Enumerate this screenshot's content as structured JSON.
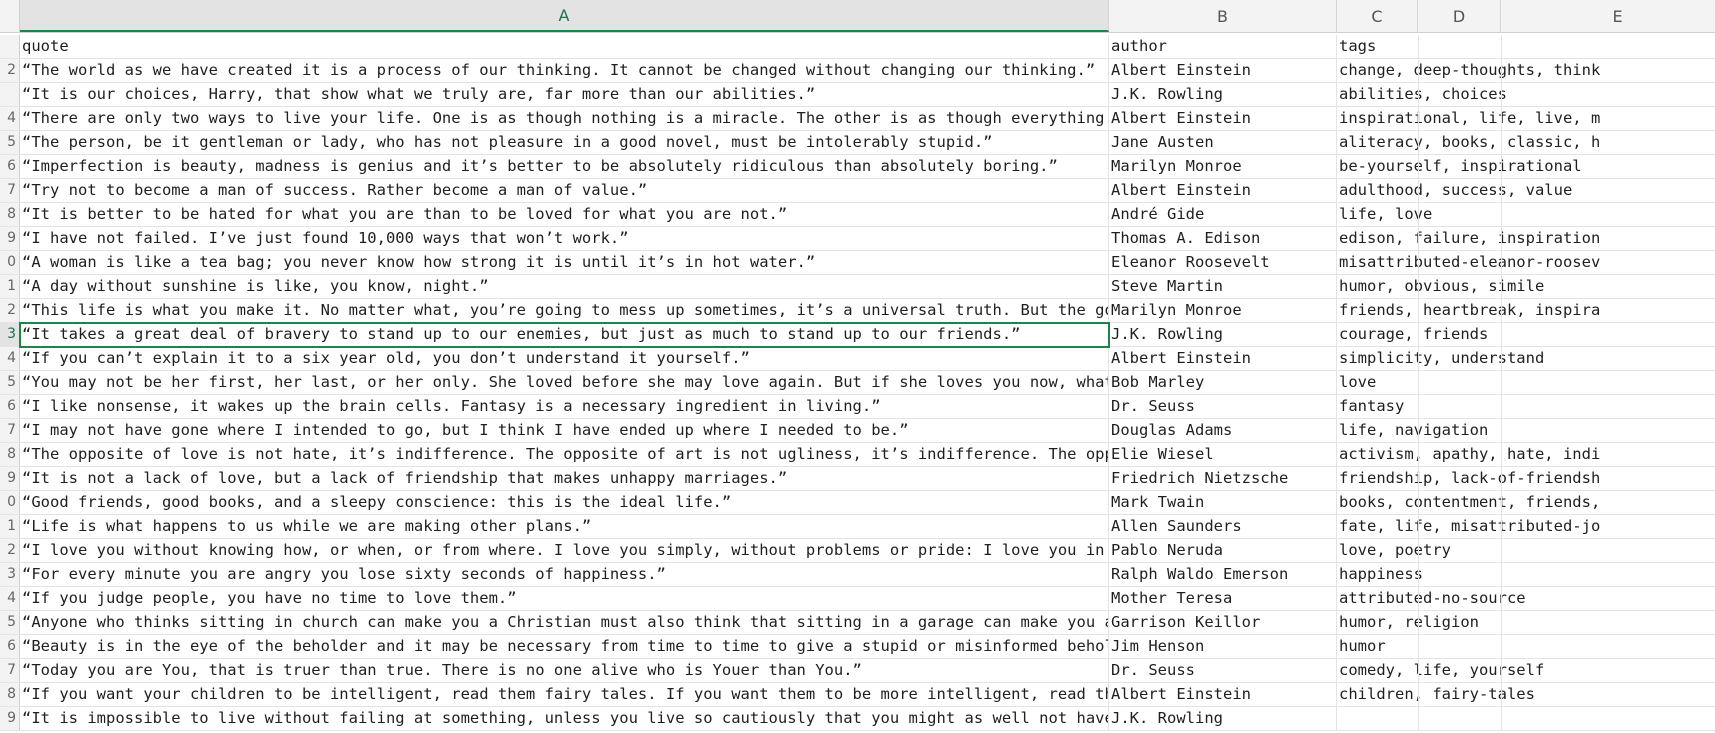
{
  "columns": [
    {
      "letter": "A",
      "selected": true
    },
    {
      "letter": "B",
      "selected": false
    },
    {
      "letter": "C",
      "selected": false
    },
    {
      "letter": "D",
      "selected": false
    },
    {
      "letter": "E",
      "selected": false
    }
  ],
  "rows": [
    {
      "num": "",
      "quote": "quote",
      "author": "author",
      "tags": "tags"
    },
    {
      "num": "2",
      "quote": "“The world as we have created it is a process of our thinking. It cannot be changed without changing our thinking.”",
      "author": "Albert Einstein",
      "tags": "change, deep-thoughts, think"
    },
    {
      "num": "",
      "quote": "“It is our choices, Harry, that show what we truly are, far more than our abilities.”",
      "author": "J.K. Rowling",
      "tags": "abilities, choices"
    },
    {
      "num": "4",
      "quote": "“There are only two ways to live your life. One is as though nothing is a miracle. The other is as though everything is a miracle.”",
      "author": "Albert Einstein",
      "tags": "inspirational, life, live, m"
    },
    {
      "num": "5",
      "quote": "“The person, be it gentleman or lady, who has not pleasure in a good novel, must be intolerably stupid.”",
      "author": "Jane Austen",
      "tags": "aliteracy, books, classic, h"
    },
    {
      "num": "6",
      "quote": "“Imperfection is beauty, madness is genius and it’s better to be absolutely ridiculous than absolutely boring.”",
      "author": "Marilyn Monroe",
      "tags": "be-yourself, inspirational"
    },
    {
      "num": "7",
      "quote": "“Try not to become a man of success. Rather become a man of value.”",
      "author": "Albert Einstein",
      "tags": "adulthood, success, value"
    },
    {
      "num": "8",
      "quote": "“It is better to be hated for what you are than to be loved for what you are not.”",
      "author": "André Gide",
      "tags": "life, love"
    },
    {
      "num": "9",
      "quote": "“I have not failed. I’ve just found 10,000 ways that won’t work.”",
      "author": "Thomas A. Edison",
      "tags": "edison, failure, inspiration"
    },
    {
      "num": "0",
      "quote": "“A woman is like a tea bag; you never know how strong it is until it’s in hot water.”",
      "author": "Eleanor Roosevelt",
      "tags": "misattributed-eleanor-roosev"
    },
    {
      "num": "1",
      "quote": "“A day without sunshine is like, you know, night.”",
      "author": "Steve Martin",
      "tags": "humor, obvious, simile"
    },
    {
      "num": "2",
      "quote": "“This life is what you make it. No matter what, you’re going to mess up sometimes, it’s a universal truth. But the good part is you",
      "author": "Marilyn Monroe",
      "tags": "friends, heartbreak, inspira"
    },
    {
      "num": "3",
      "quote": "“It takes a great deal of bravery to stand up to our enemies, but just as much to stand up to our friends.”",
      "author": "J.K. Rowling",
      "tags": "courage, friends"
    },
    {
      "num": "4",
      "quote": "“If you can’t explain it to a six year old, you don’t understand it yourself.”",
      "author": "Albert Einstein",
      "tags": "simplicity, understand"
    },
    {
      "num": "5",
      "quote": "“You may not be her first, her last, or her only. She loved before she may love again. But if she loves you now, what else matters?",
      "author": "Bob Marley",
      "tags": "love"
    },
    {
      "num": "6",
      "quote": "“I like nonsense, it wakes up the brain cells. Fantasy is a necessary ingredient in living.”",
      "author": "Dr. Seuss",
      "tags": "fantasy"
    },
    {
      "num": "7",
      "quote": "“I may not have gone where I intended to go, but I think I have ended up where I needed to be.”",
      "author": "Douglas Adams",
      "tags": "life, navigation"
    },
    {
      "num": "8",
      "quote": "“The opposite of love is not hate, it’s indifference. The opposite of art is not ugliness, it’s indifference. The opposite of faith",
      "author": "Elie Wiesel",
      "tags": "activism, apathy, hate, indi"
    },
    {
      "num": "9",
      "quote": "“It is not a lack of love, but a lack of friendship that makes unhappy marriages.”",
      "author": "Friedrich Nietzsche",
      "tags": "friendship, lack-of-friendsh"
    },
    {
      "num": "0",
      "quote": "“Good friends, good books, and a sleepy conscience: this is the ideal life.”",
      "author": "Mark Twain",
      "tags": "books, contentment, friends,"
    },
    {
      "num": "1",
      "quote": "“Life is what happens to us while we are making other plans.”",
      "author": "Allen Saunders",
      "tags": "fate, life, misattributed-jo"
    },
    {
      "num": "2",
      "quote": "“I love you without knowing how, or when, or from where. I love you simply, without problems or pride: I love you in this way becau",
      "author": "Pablo Neruda",
      "tags": "love, poetry"
    },
    {
      "num": "3",
      "quote": "“For every minute you are angry you lose sixty seconds of happiness.”",
      "author": "Ralph Waldo Emerson",
      "tags": "happiness"
    },
    {
      "num": "4",
      "quote": "“If you judge people, you have no time to love them.”",
      "author": "Mother Teresa",
      "tags": "attributed-no-source"
    },
    {
      "num": "5",
      "quote": "“Anyone who thinks sitting in church can make you a Christian must also think that sitting in a garage can make you a car.”",
      "author": "Garrison Keillor",
      "tags": "humor, religion"
    },
    {
      "num": "6",
      "quote": "“Beauty is in the eye of the beholder and it may be necessary from time to time to give a stupid or misinformed beholder a black ey",
      "author": "Jim Henson",
      "tags": "humor"
    },
    {
      "num": "7",
      "quote": "“Today you are You, that is truer than true. There is no one alive who is Youer than You.”",
      "author": "Dr. Seuss",
      "tags": "comedy, life, yourself"
    },
    {
      "num": "8",
      "quote": "“If you want your children to be intelligent, read them fairy tales. If you want them to be more intelligent, read them more fairy",
      "author": "Albert Einstein",
      "tags": "children, fairy-tales"
    },
    {
      "num": "9",
      "quote": "“It is impossible to live without failing at something, unless you live so cautiously that you might as well not have lived at all",
      "author": "J.K. Rowling",
      "tags": ""
    }
  ],
  "selection": {
    "row_index": 12,
    "row_num": "3",
    "column": "A"
  },
  "colors": {
    "accent": "#1e8449",
    "header_bg": "#f3f3f3",
    "gridline": "#e4e4e4"
  }
}
